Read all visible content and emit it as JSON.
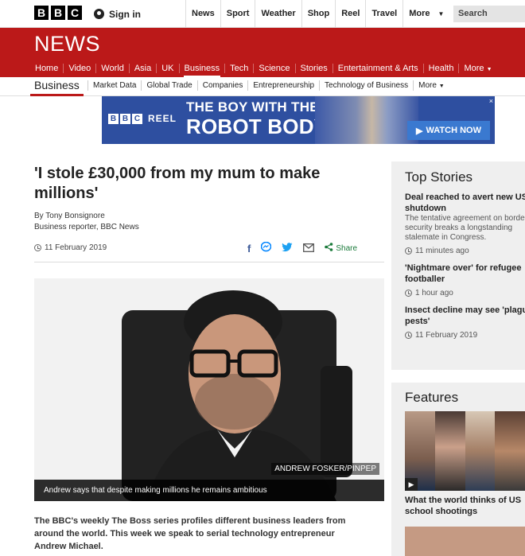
{
  "topbar": {
    "logo_letters": [
      "B",
      "B",
      "C"
    ],
    "signin": "Sign in",
    "nav": [
      "News",
      "Sport",
      "Weather",
      "Shop",
      "Reel",
      "Travel"
    ],
    "more": "More",
    "search_placeholder": "Search"
  },
  "header": {
    "brand": "NEWS",
    "nav": [
      "Home",
      "Video",
      "World",
      "Asia",
      "UK",
      "Business",
      "Tech",
      "Science",
      "Stories",
      "Entertainment & Arts",
      "Health",
      "More"
    ],
    "active": "Business"
  },
  "subnav": {
    "section": "Business",
    "items": [
      "Market Data",
      "Global Trade",
      "Companies",
      "Entrepreneurship",
      "Technology of Business",
      "More"
    ]
  },
  "ad": {
    "brand_letters": [
      "B",
      "B",
      "C"
    ],
    "brand_suffix": "REEL",
    "line1": "THE BOY WITH THE",
    "line2": "ROBOT BODY",
    "cta": "WATCH NOW",
    "close": "×"
  },
  "article": {
    "headline": "'I stole £30,000 from my mum to make millions'",
    "author": "By Tony Bonsignore",
    "role": "Business reporter, BBC News",
    "date": "11 February 2019",
    "share_label": "Share",
    "image_credit": "ANDREW FOSKER/PINPEP",
    "image_caption": "Andrew says that despite making millions he remains ambitious",
    "intro": "The BBC's weekly The Boss series profiles different business leaders from around the world. This week we speak to serial technology entrepreneur Andrew Michael."
  },
  "top_stories": {
    "title": "Top Stories",
    "items": [
      {
        "title_lines": [
          "Deal reached to avert new US",
          "shutdown"
        ],
        "desc_lines": [
          "The tentative agreement on borde",
          "security breaks a longstanding",
          "stalemate in Congress."
        ],
        "time": "11 minutes ago"
      },
      {
        "title_lines": [
          "'Nightmare over' for refugee",
          "footballer"
        ],
        "desc_lines": [],
        "time": "1 hour ago"
      },
      {
        "title_lines": [
          "Insect decline may see 'plagu",
          "pests'"
        ],
        "desc_lines": [],
        "time": "11 February 2019"
      }
    ]
  },
  "features": {
    "title": "Features",
    "item_title_lines": [
      "What the world thinks of US",
      "school shootings"
    ]
  },
  "colors": {
    "brand_red": "#bb1919",
    "share_green": "#1a7a3a",
    "ad_blue": "#2e4fa0"
  }
}
